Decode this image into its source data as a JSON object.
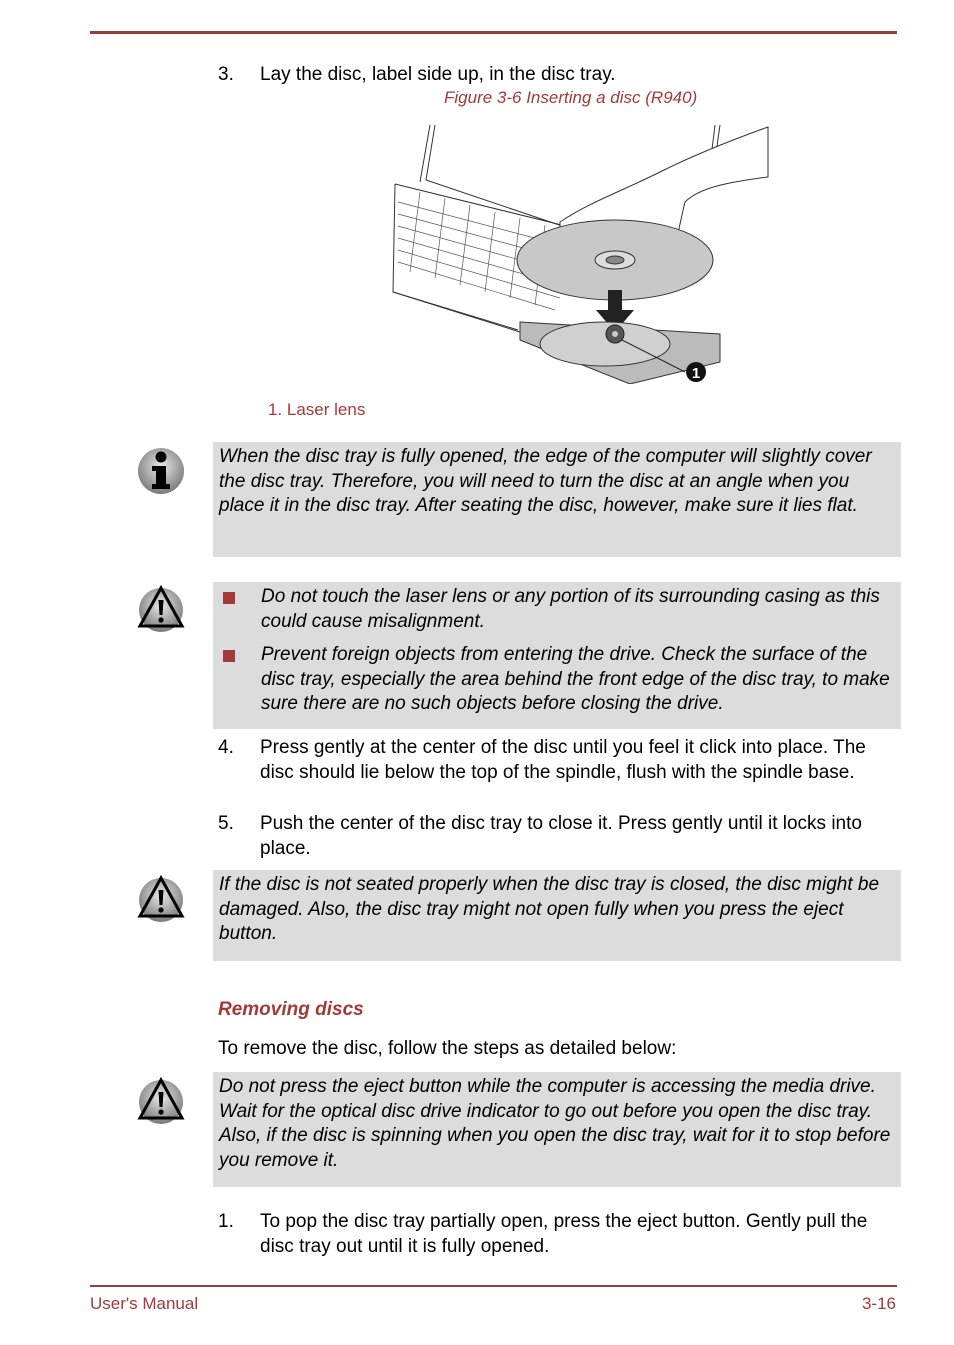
{
  "page": {
    "footer_left": "User's Manual",
    "footer_right": "3-16",
    "accent_color": "#a33a3a",
    "note_bg_color": "#dcdcdc"
  },
  "steps_top": [
    {
      "num": "3.",
      "text": "Lay the disc, label side up, in the disc tray."
    }
  ],
  "figure": {
    "caption": "Figure 3-6 Inserting a disc (R940)",
    "callout_number": "1",
    "legend": "1. Laser lens"
  },
  "notes": {
    "info": {
      "icon": "info-icon",
      "text": "When the disc tray is fully opened, the edge of the computer will slightly cover the disc tray. Therefore, you will need to turn the disc at an angle when you place it in the disc tray. After seating the disc, however, make sure it lies flat."
    },
    "caution1": {
      "icon": "warning-icon",
      "items": [
        "Do not touch the laser lens or any portion of its surrounding casing as this could cause misalignment.",
        "Prevent foreign objects from entering the drive. Check the surface of the disc tray, especially the area behind the front edge of the disc tray, to make sure there are no such objects before closing the drive."
      ]
    },
    "caution2": {
      "icon": "warning-icon",
      "text": "If the disc is not seated properly when the disc tray is closed, the disc might be damaged. Also, the disc tray might not open fully when you press the eject button."
    },
    "caution3": {
      "icon": "warning-icon",
      "text": "Do not press the eject button while the computer is accessing the media drive. Wait for the optical disc drive indicator to go out before you open the disc tray. Also, if the disc is spinning when you open the disc tray, wait for it to stop before you remove it."
    }
  },
  "steps_middle": [
    {
      "num": "4.",
      "text": "Press gently at the center of the disc until you feel it click into place. The disc should lie below the top of the spindle, flush with the spindle base."
    },
    {
      "num": "5.",
      "text": "Push the center of the disc tray to close it. Press gently until it locks into place."
    }
  ],
  "removing": {
    "heading": "Removing discs",
    "intro": "To remove the disc, follow the steps as detailed below:"
  },
  "steps_bottom": [
    {
      "num": "1.",
      "text": "To pop the disc tray partially open, press the eject button. Gently pull the disc tray out until it is fully opened."
    }
  ]
}
